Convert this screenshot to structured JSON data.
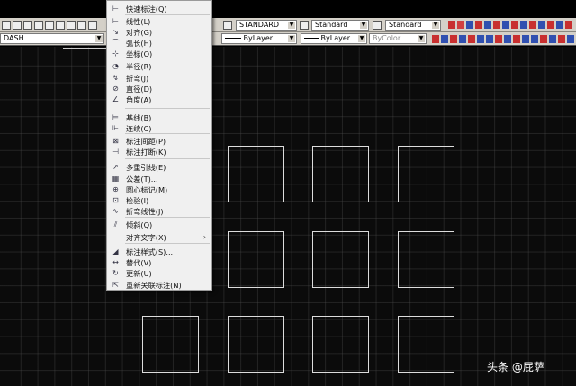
{
  "toolbar_top": {
    "text_style": "STANDARD",
    "dim_style": "Standard",
    "table_style": "Standard"
  },
  "toolbar_layers": {
    "linetype_left": "DASH",
    "linetype": "ByLayer",
    "lineweight": "ByLayer",
    "plot_color": "ByColor"
  },
  "dimension_menu": {
    "items": [
      {
        "icon": "quick-dimension-icon",
        "glyph": "⊢",
        "label": "快速标注(Q)"
      },
      {
        "icon": "linear-icon",
        "glyph": "⊢",
        "label": "线性(L)"
      },
      {
        "icon": "aligned-icon",
        "glyph": "↘",
        "label": "对齐(G)"
      },
      {
        "icon": "arc-length-icon",
        "glyph": "⌒",
        "label": "弧长(H)"
      },
      {
        "icon": "ordinate-icon",
        "glyph": "⊹",
        "label": "坐标(O)"
      },
      {
        "icon": "radius-icon",
        "glyph": "◔",
        "label": "半径(R)"
      },
      {
        "icon": "jogged-icon",
        "glyph": "↯",
        "label": "折弯(J)"
      },
      {
        "icon": "diameter-icon",
        "glyph": "⊘",
        "label": "直径(D)"
      },
      {
        "icon": "angular-icon",
        "glyph": "∠",
        "label": "角度(A)"
      },
      {
        "icon": "baseline-icon",
        "glyph": "⊨",
        "label": "基线(B)"
      },
      {
        "icon": "continue-icon",
        "glyph": "⊩",
        "label": "连续(C)"
      },
      {
        "icon": "dim-space-icon",
        "glyph": "⊠",
        "label": "标注间距(P)"
      },
      {
        "icon": "dim-break-icon",
        "glyph": "⊣",
        "label": "标注打断(K)"
      },
      {
        "icon": "multileader-icon",
        "glyph": "↗",
        "label": "多重引线(E)"
      },
      {
        "icon": "tolerance-icon",
        "glyph": "▦",
        "label": "公差(T)..."
      },
      {
        "icon": "center-mark-icon",
        "glyph": "⊕",
        "label": "圆心标记(M)"
      },
      {
        "icon": "inspection-icon",
        "glyph": "⊡",
        "label": "检验(I)"
      },
      {
        "icon": "jogged-linear-icon",
        "glyph": "∿",
        "label": "折弯线性(J)"
      },
      {
        "icon": "oblique-icon",
        "glyph": "⫽",
        "label": "倾斜(Q)"
      },
      {
        "icon": "",
        "glyph": "",
        "label": "对齐文字(X)",
        "submenu": "›"
      },
      {
        "icon": "dim-style-icon",
        "glyph": "◢",
        "label": "标注样式(S)..."
      },
      {
        "icon": "override-icon",
        "glyph": "↔",
        "label": "替代(V)"
      },
      {
        "icon": "update-icon",
        "glyph": "↻",
        "label": "更新(U)"
      },
      {
        "icon": "reassociate-icon",
        "glyph": "⇱",
        "label": "重新关联标注(N)"
      }
    ]
  },
  "watermark": "头条 @屁萨"
}
